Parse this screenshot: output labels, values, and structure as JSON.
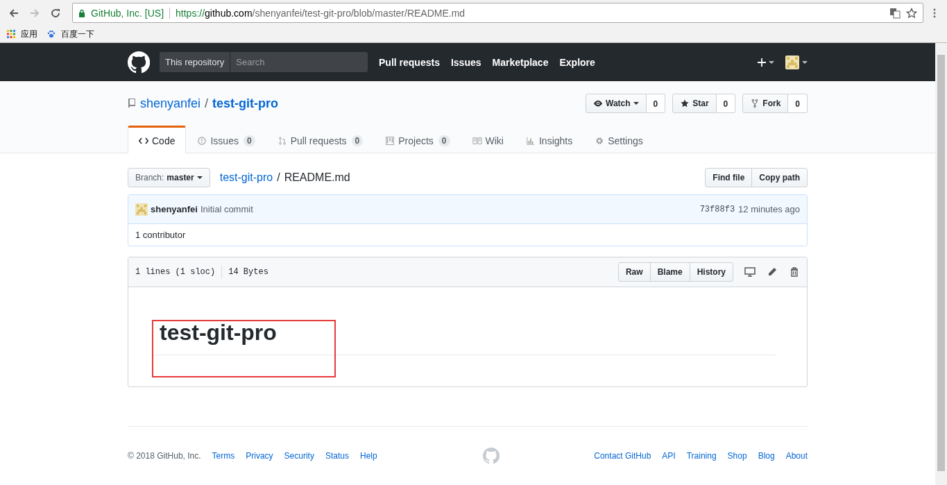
{
  "browser": {
    "identity": "GitHub, Inc. [US]",
    "url_scheme": "https://",
    "url_host": "github.com",
    "url_path": "/shenyanfei/test-git-pro/blob/master/README.md",
    "bookmarks": [
      {
        "label": "应用",
        "kind": "apps"
      },
      {
        "label": "百度一下",
        "kind": "paw"
      }
    ]
  },
  "header": {
    "scope": "This repository",
    "search_placeholder": "Search",
    "nav": [
      "Pull requests",
      "Issues",
      "Marketplace",
      "Explore"
    ]
  },
  "repo": {
    "owner": "shenyanfei",
    "separator": "/",
    "name": "test-git-pro",
    "actions": [
      {
        "label": "Watch",
        "kind": "watch",
        "count": "0"
      },
      {
        "label": "Star",
        "kind": "star",
        "count": "0"
      },
      {
        "label": "Fork",
        "kind": "fork",
        "count": "0"
      }
    ],
    "tabs": [
      {
        "label": "Code",
        "kind": "code",
        "selected": true
      },
      {
        "label": "Issues",
        "kind": "issue",
        "count": "0",
        "selected": false
      },
      {
        "label": "Pull requests",
        "kind": "pr",
        "count": "0",
        "selected": false
      },
      {
        "label": "Projects",
        "kind": "project",
        "count": "0",
        "selected": false
      },
      {
        "label": "Wiki",
        "kind": "wiki",
        "selected": false
      },
      {
        "label": "Insights",
        "kind": "graph",
        "selected": false
      },
      {
        "label": "Settings",
        "kind": "gear",
        "selected": false
      }
    ]
  },
  "file_nav": {
    "branch_label": "Branch:",
    "branch": "master",
    "repo_link": "test-git-pro",
    "separator": "/",
    "file": "README.md",
    "buttons": [
      "Find file",
      "Copy path"
    ]
  },
  "commit": {
    "author": "shenyanfei",
    "message": "Initial commit",
    "sha": "73f88f3",
    "time": "12 minutes ago",
    "contributors": "1 contributor"
  },
  "file": {
    "lines": "1 lines (1 sloc)",
    "size": "14 Bytes",
    "buttons": [
      "Raw",
      "Blame",
      "History"
    ],
    "heading": "test-git-pro"
  },
  "footer": {
    "copyright": "© 2018 GitHub, Inc.",
    "left_links": [
      "Terms",
      "Privacy",
      "Security",
      "Status",
      "Help"
    ],
    "right_links": [
      "Contact GitHub",
      "API",
      "Training",
      "Shop",
      "Blog",
      "About"
    ]
  }
}
